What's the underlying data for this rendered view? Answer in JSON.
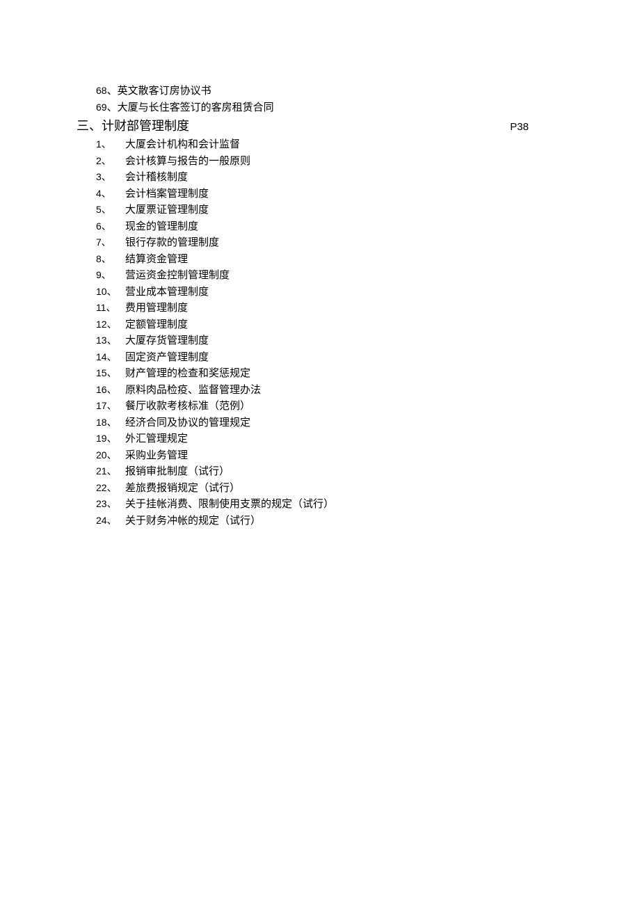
{
  "prev_items": [
    {
      "num": "68",
      "text": "英文散客订房协议书"
    },
    {
      "num": "69",
      "text": "大厦与长住客签订的客房租赁合同"
    }
  ],
  "section": {
    "title": "三、计财部管理制度",
    "page": "P38"
  },
  "sub_items": [
    {
      "num": "1",
      "text": "大厦会计机构和会计监督"
    },
    {
      "num": "2",
      "text": "会计核算与报告的一般原则"
    },
    {
      "num": "3",
      "text": "会计稽核制度"
    },
    {
      "num": "4",
      "text": "会计档案管理制度"
    },
    {
      "num": "5",
      "text": "大厦票证管理制度"
    },
    {
      "num": "6",
      "text": "现金的管理制度"
    },
    {
      "num": "7",
      "text": "银行存款的管理制度"
    },
    {
      "num": "8",
      "text": "结算资金管理"
    },
    {
      "num": "9",
      "text": "营运资金控制管理制度"
    },
    {
      "num": "10",
      "text": "营业成本管理制度"
    },
    {
      "num": "11",
      "text": "费用管理制度"
    },
    {
      "num": "12",
      "text": "定额管理制度"
    },
    {
      "num": "13",
      "text": "大厦存货管理制度"
    },
    {
      "num": "14",
      "text": "固定资产管理制度"
    },
    {
      "num": "15",
      "text": "财产管理的检查和奖惩规定"
    },
    {
      "num": "16",
      "text": "原料肉品检疫、监督管理办法"
    },
    {
      "num": "17",
      "text": "餐厅收款考核标准（范例）"
    },
    {
      "num": "18",
      "text": "经济合同及协议的管理规定"
    },
    {
      "num": "19",
      "text": "外汇管理规定"
    },
    {
      "num": "20",
      "text": "采购业务管理"
    },
    {
      "num": "21",
      "text": "报销审批制度（试行）"
    },
    {
      "num": "22",
      "text": "差旅费报销规定（试行）"
    },
    {
      "num": "23",
      "text": "关于挂帐消费、限制使用支票的规定（试行）"
    },
    {
      "num": "24",
      "text": "关于财务冲帐的规定（试行）"
    }
  ]
}
